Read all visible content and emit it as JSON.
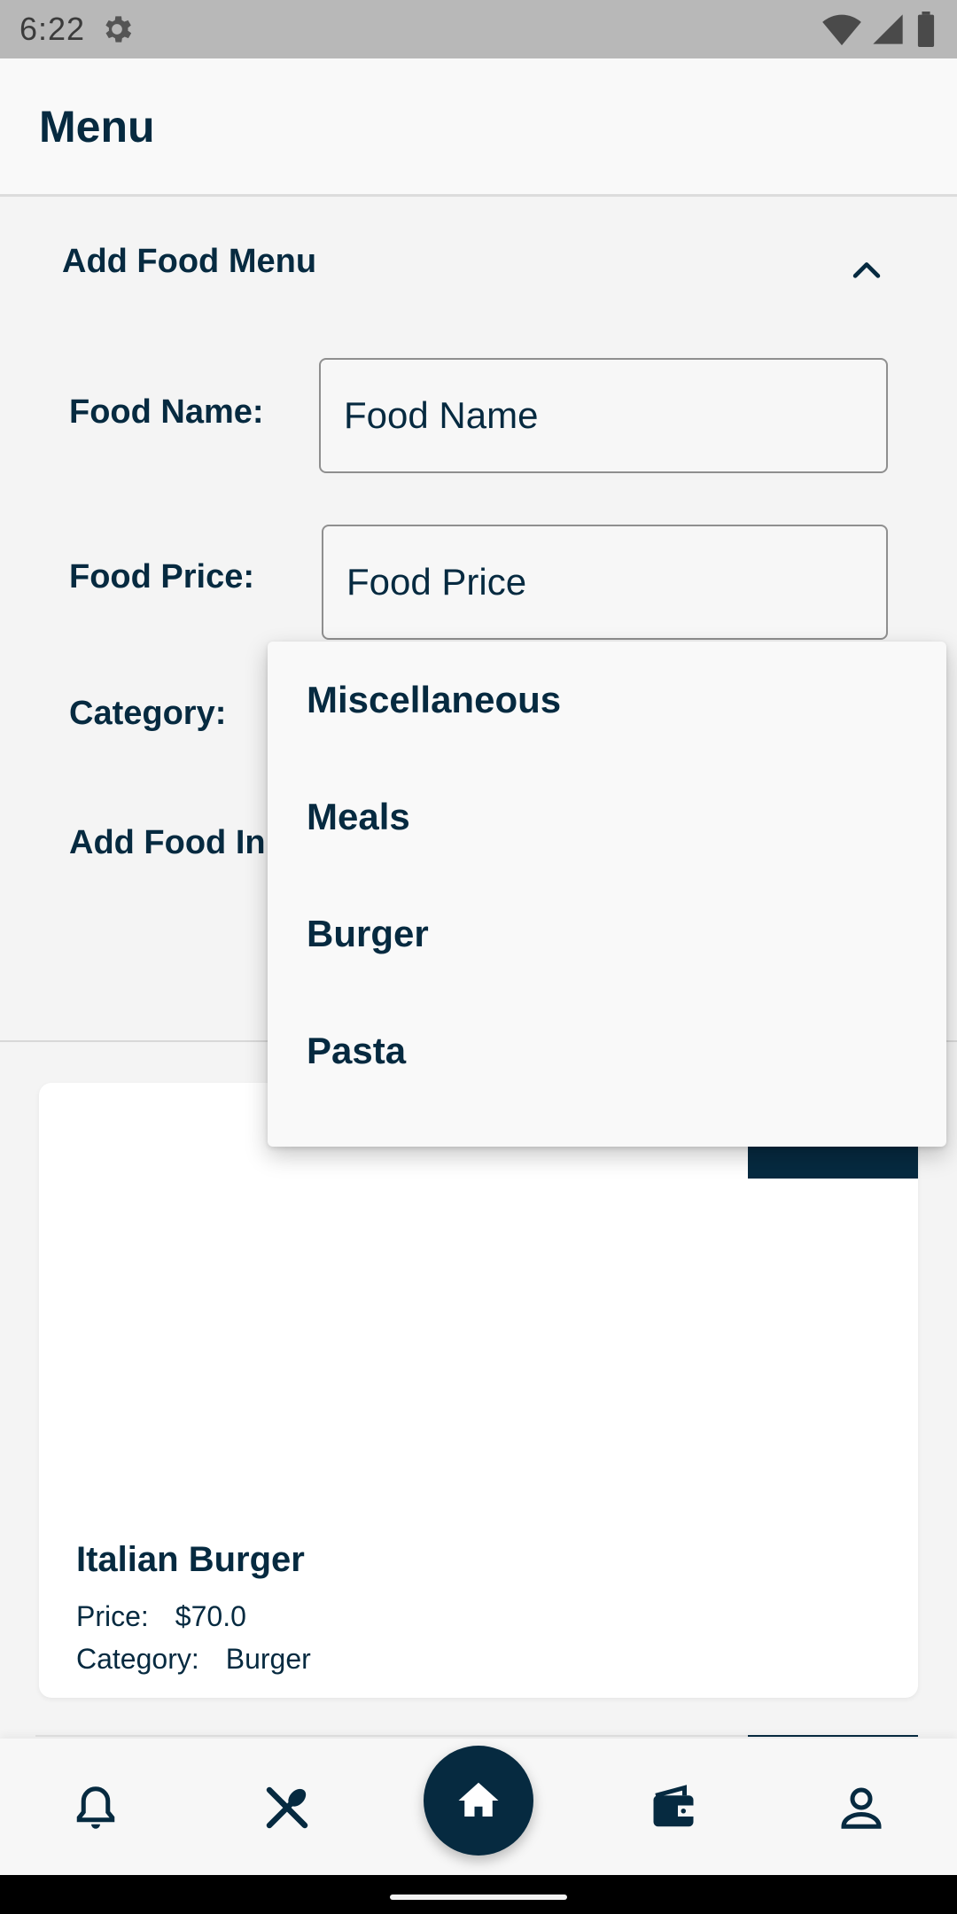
{
  "status_bar": {
    "time": "6:22"
  },
  "app_bar": {
    "title": "Menu"
  },
  "panel": {
    "title": "Add Food Menu",
    "labels": {
      "food_name": "Food Name:",
      "food_price": "Food Price:",
      "category": "Category:",
      "add_food_image": "Add Food In"
    },
    "fields": {
      "food_name_placeholder": "Food Name",
      "food_price_placeholder": "Food Price"
    }
  },
  "category_dropdown": {
    "options": [
      "Miscellaneous",
      "Meals",
      "Burger",
      "Pasta"
    ]
  },
  "food_card": {
    "name": "Italian Burger",
    "price_label": "Price:",
    "price_value": "$70.0",
    "category_label": "Category:",
    "category_value": "Burger"
  },
  "bottom_nav": {
    "items": [
      {
        "icon": "bell-icon"
      },
      {
        "icon": "utensils-icon"
      },
      {
        "icon": "home-icon"
      },
      {
        "icon": "wallet-icon"
      },
      {
        "icon": "person-icon"
      }
    ]
  },
  "colors": {
    "primary": "#062a40",
    "background": "#f4f4f4",
    "status_bar": "#b8b8b8"
  }
}
